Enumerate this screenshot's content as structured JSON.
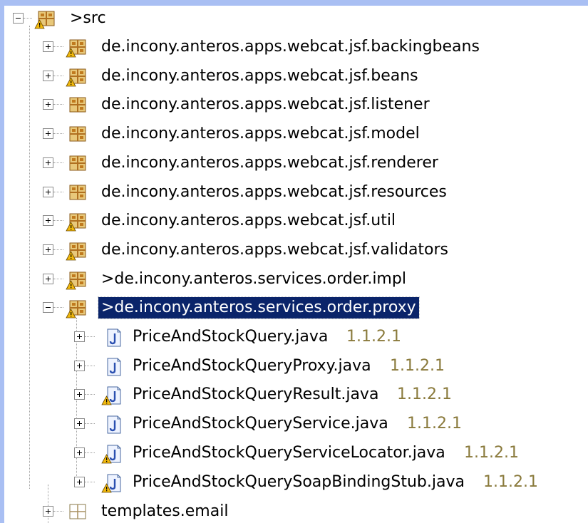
{
  "root": {
    "label": ">src",
    "icon": "package-folder-warning-icon",
    "expanded": true
  },
  "packages": [
    {
      "label": "de.incony.anteros.apps.webcat.jsf.backingbeans",
      "icon": "package-warning-icon",
      "expanded": false
    },
    {
      "label": "de.incony.anteros.apps.webcat.jsf.beans",
      "icon": "package-warning-icon",
      "expanded": false
    },
    {
      "label": "de.incony.anteros.apps.webcat.jsf.listener",
      "icon": "package-icon",
      "expanded": false
    },
    {
      "label": "de.incony.anteros.apps.webcat.jsf.model",
      "icon": "package-icon",
      "expanded": false
    },
    {
      "label": "de.incony.anteros.apps.webcat.jsf.renderer",
      "icon": "package-icon",
      "expanded": false
    },
    {
      "label": "de.incony.anteros.apps.webcat.jsf.resources",
      "icon": "package-icon",
      "expanded": false
    },
    {
      "label": "de.incony.anteros.apps.webcat.jsf.util",
      "icon": "package-warning-icon",
      "expanded": false
    },
    {
      "label": "de.incony.anteros.apps.webcat.jsf.validators",
      "icon": "package-warning-icon",
      "expanded": false
    },
    {
      "label": ">de.incony.anteros.services.order.impl",
      "icon": "package-warning-icon",
      "expanded": false
    },
    {
      "label": ">de.incony.anteros.services.order.proxy",
      "icon": "package-warning-icon",
      "expanded": true,
      "selected": true
    }
  ],
  "files": [
    {
      "name": "PriceAndStockQuery.java",
      "version": "1.1.2.1",
      "icon": "java-file-icon"
    },
    {
      "name": "PriceAndStockQueryProxy.java",
      "version": "1.1.2.1",
      "icon": "java-file-icon"
    },
    {
      "name": "PriceAndStockQueryResult.java",
      "version": "1.1.2.1",
      "icon": "java-file-warning-icon"
    },
    {
      "name": "PriceAndStockQueryService.java",
      "version": "1.1.2.1",
      "icon": "java-file-icon"
    },
    {
      "name": "PriceAndStockQueryServiceLocator.java",
      "version": "1.1.2.1",
      "icon": "java-file-warning-icon"
    },
    {
      "name": "PriceAndStockQuerySoapBindingStub.java",
      "version": "1.1.2.1",
      "icon": "java-file-warning-icon"
    }
  ],
  "tail": {
    "label": "templates.email",
    "icon": "empty-package-icon",
    "expanded": false
  },
  "colors": {
    "selection": "#0a246a",
    "version_text": "#8a7a3c",
    "background_frame": "#a9bff3",
    "package_box": "#b98a3a",
    "warning": "#f2b90c"
  }
}
